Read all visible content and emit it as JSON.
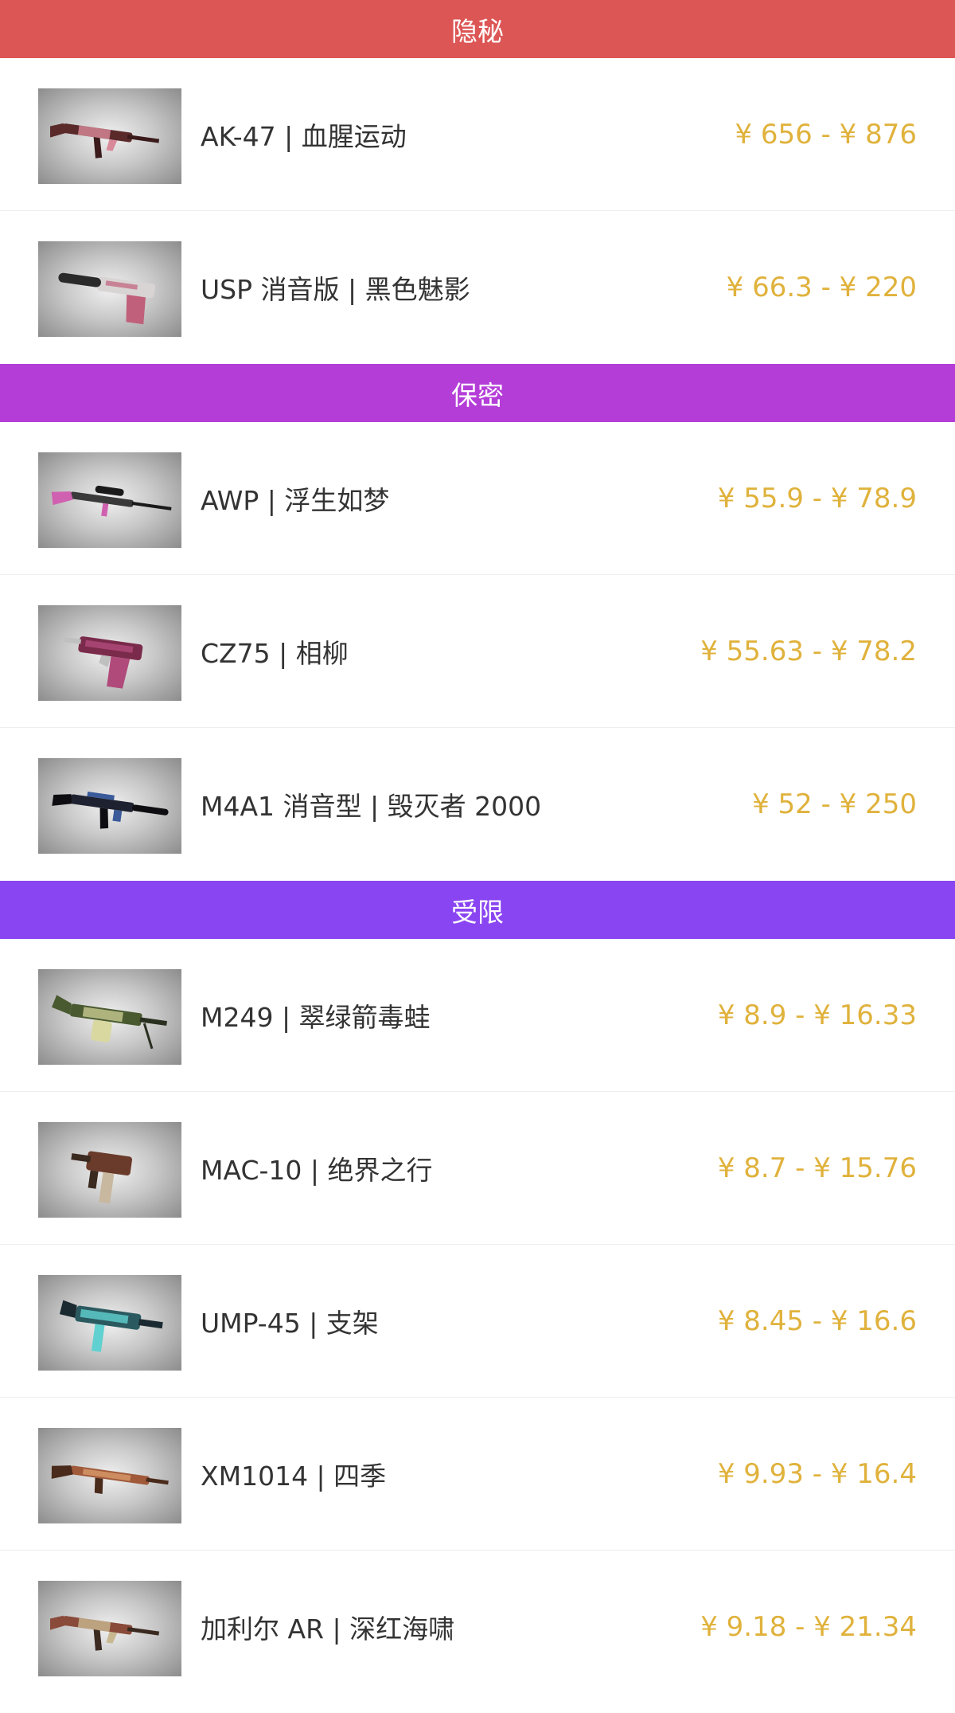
{
  "sections": [
    {
      "title": "隐秘",
      "color": "#dc5655",
      "items": [
        {
          "name": "AK-47 | 血腥运动",
          "price": "¥ 656 - ¥ 876",
          "icon": "ak47-skin-icon",
          "weapon": "rifle",
          "skin": [
            "#5a2a2a",
            "#d98a9a",
            "#3a1a1a"
          ]
        },
        {
          "name": "USP 消音版 | 黑色魅影",
          "price": "¥ 66.3 - ¥ 220",
          "icon": "usp-skin-icon",
          "weapon": "pistol-suppressed",
          "skin": [
            "#d9d4d4",
            "#c0607a",
            "#2a2a2a"
          ]
        }
      ]
    },
    {
      "title": "保密",
      "color": "#b43dd8",
      "items": [
        {
          "name": "AWP | 浮生如梦",
          "price": "¥ 55.9 - ¥ 78.9",
          "icon": "awp-skin-icon",
          "weapon": "sniper",
          "skin": [
            "#3a3a3a",
            "#d060b0",
            "#1a1a1a"
          ]
        },
        {
          "name": "CZ75 | 相柳",
          "price": "¥ 55.63 - ¥ 78.2",
          "icon": "cz75-skin-icon",
          "weapon": "pistol",
          "skin": [
            "#7a2a4a",
            "#b04a7a",
            "#c0c0c0"
          ]
        },
        {
          "name": "M4A1 消音型 | 毁灭者 2000",
          "price": "¥ 52 - ¥ 250",
          "icon": "m4a1s-skin-icon",
          "weapon": "rifle-suppressed",
          "skin": [
            "#1e2230",
            "#3a5a9a",
            "#0e0e12"
          ]
        }
      ]
    },
    {
      "title": "受限",
      "color": "#8a45f2",
      "items": [
        {
          "name": "M249 | 翠绿箭毒蛙",
          "price": "¥ 8.9 - ¥ 16.33",
          "icon": "m249-skin-icon",
          "weapon": "lmg",
          "skin": [
            "#4a5a30",
            "#d8d8a0",
            "#2a3020"
          ]
        },
        {
          "name": "MAC-10 | 绝界之行",
          "price": "¥ 8.7 - ¥ 15.76",
          "icon": "mac10-skin-icon",
          "weapon": "smg-compact",
          "skin": [
            "#6a3a2a",
            "#c8b8a0",
            "#3a2a20"
          ]
        },
        {
          "name": "UMP-45 | 支架",
          "price": "¥ 8.45 - ¥ 16.6",
          "icon": "ump45-skin-icon",
          "weapon": "smg",
          "skin": [
            "#2a5a60",
            "#60d0d0",
            "#1a2a30"
          ]
        },
        {
          "name": "XM1014 | 四季",
          "price": "¥ 9.93 - ¥ 16.4",
          "icon": "xm1014-skin-icon",
          "weapon": "shotgun",
          "skin": [
            "#a05a3a",
            "#d89a6a",
            "#4a2a1a"
          ]
        },
        {
          "name": "加利尔 AR | 深红海啸",
          "price": "¥ 9.18 - ¥ 21.34",
          "icon": "galil-skin-icon",
          "weapon": "rifle",
          "skin": [
            "#8a4a3a",
            "#c8b890",
            "#3a2a20"
          ]
        }
      ]
    }
  ]
}
